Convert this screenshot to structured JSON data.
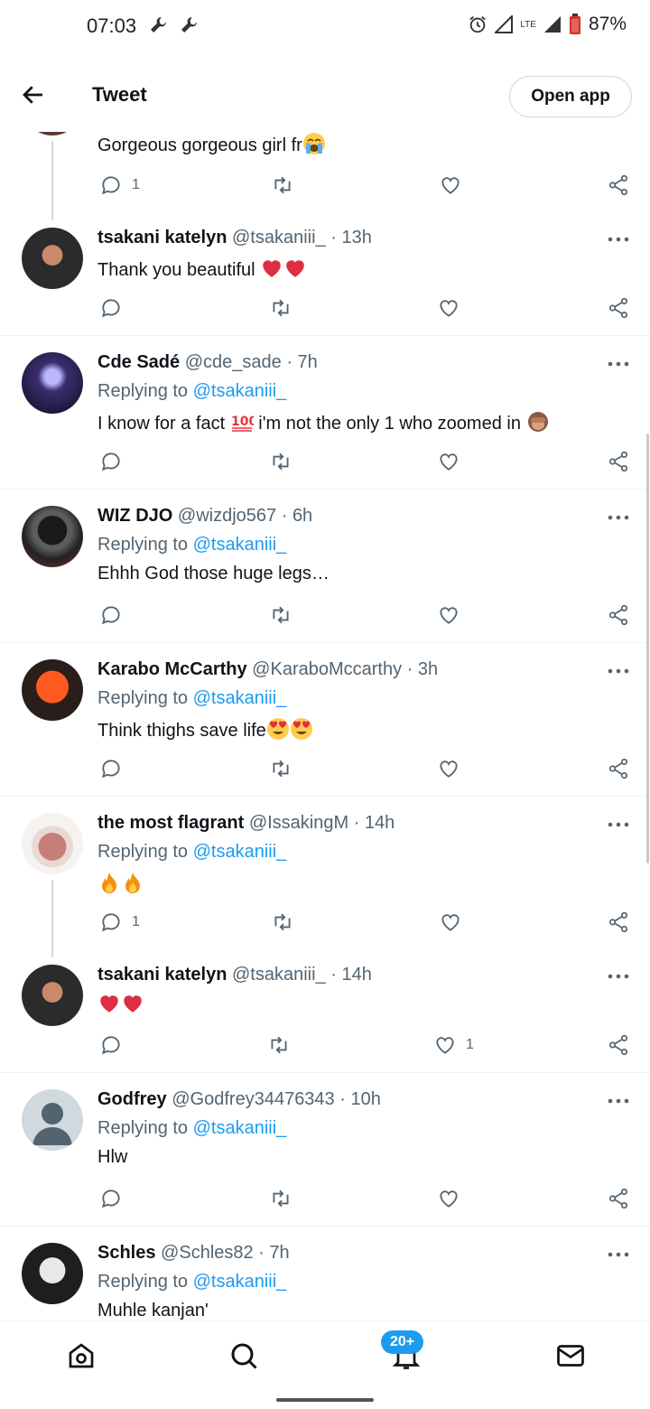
{
  "status_bar": {
    "time": "07:03",
    "lte": "LTE",
    "battery": "87%"
  },
  "header": {
    "title": "Tweet",
    "open_app_label": "Open app"
  },
  "top_tweet": {
    "text": "Gorgeous gorgeous girl fr",
    "reply_count": "1"
  },
  "tweets": [
    {
      "name": "tsakani katelyn",
      "handle": "@tsakaniii_",
      "time": "13h",
      "replying_label": "",
      "replying_handle": "",
      "text": "Thank you beautiful",
      "reply_count": "",
      "like_count": ""
    },
    {
      "name": "Cde Sadé",
      "handle": "@cde_sade",
      "time": "7h",
      "replying_label": "Replying to",
      "replying_handle": "@tsakaniii_",
      "text_a": "I know for a fact",
      "text_b": "i'm not the only 1 who zoomed in",
      "reply_count": "",
      "like_count": ""
    },
    {
      "name": "WIZ DJO",
      "handle": "@wizdjo567",
      "time": "6h",
      "replying_label": "Replying to",
      "replying_handle": "@tsakaniii_",
      "text": "Ehhh God those huge legs…"
    },
    {
      "name": "Karabo McCarthy",
      "handle": "@KaraboMccarthy",
      "time": "3h",
      "replying_label": "Replying to",
      "replying_handle": "@tsakaniii_",
      "text": "Think thighs save life"
    },
    {
      "name": "the most flagrant",
      "handle": "@IssakingM",
      "time": "14h",
      "replying_label": "Replying to",
      "replying_handle": "@tsakaniii_",
      "text": "",
      "reply_count": "1"
    },
    {
      "name": "tsakani katelyn",
      "handle": "@tsakaniii_",
      "time": "14h",
      "text": "",
      "like_count": "1"
    },
    {
      "name": "Godfrey",
      "handle": "@Godfrey34476343",
      "time": "10h",
      "replying_label": "Replying to",
      "replying_handle": "@tsakaniii_",
      "text": "Hlw"
    },
    {
      "name": "Schles",
      "handle": "@Schles82",
      "time": "7h",
      "replying_label": "Replying to",
      "replying_handle": "@tsakaniii_",
      "text": "Muhle kanjan'"
    }
  ],
  "meta_separator": " · ",
  "nav": {
    "notifications_badge": "20+"
  },
  "icons": {
    "reply": "reply-icon",
    "retweet": "retweet-icon",
    "like": "heart-icon",
    "share": "share-icon",
    "more": "more-icon",
    "home": "home-icon",
    "search": "search-icon",
    "bell": "bell-icon",
    "mail": "mail-icon"
  },
  "colors": {
    "accent": "#1d9bf0",
    "text": "#0f1419",
    "muted": "#536471",
    "heart": "#e0245e"
  }
}
